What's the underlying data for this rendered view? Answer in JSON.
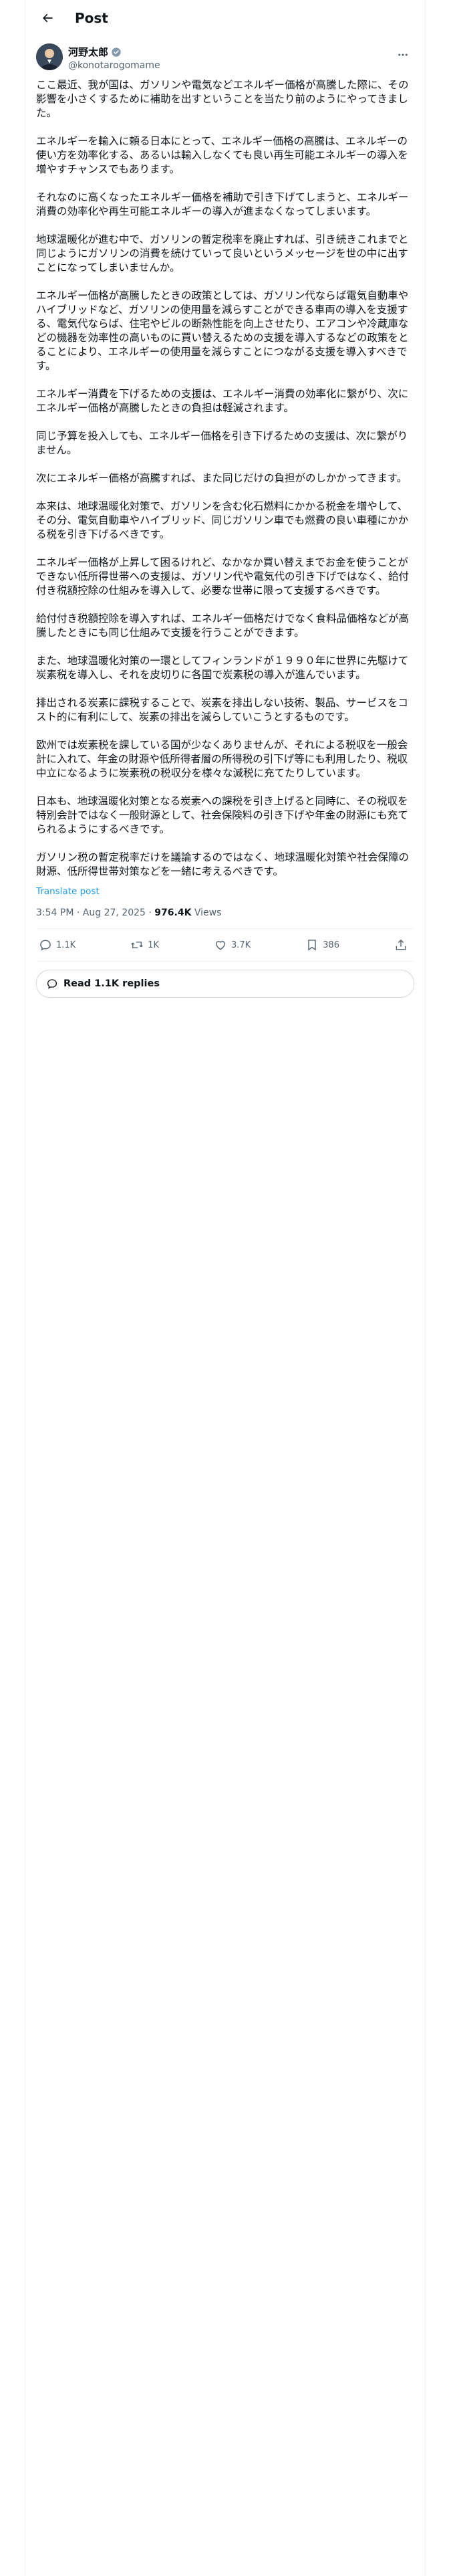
{
  "header": {
    "title": "Post"
  },
  "post": {
    "author_name": "河野太郎",
    "author_handle": "@konotarogomame",
    "paragraphs": [
      "ここ最近、我が国は、ガソリンや電気などエネルギー価格が高騰した際に、その影響を小さくするために補助を出すということを当たり前のようにやってきました。",
      "エネルギーを輸入に頼る日本にとって、エネルギー価格の高騰は、エネルギーの使い方を効率化する、あるいは輸入しなくても良い再生可能エネルギーの導入を増やすチャンスでもあります。",
      "それなのに高くなったエネルギー価格を補助で引き下げてしまうと、エネルギー消費の効率化や再生可能エネルギーの導入が進まなくなってしまいます。",
      "地球温暖化が進む中で、ガソリンの暫定税率を廃止すれば、引き続きこれまでと同じようにガソリンの消費を続けていって良いというメッセージを世の中に出すことになってしまいませんか。",
      "エネルギー価格が高騰したときの政策としては、ガソリン代ならば電気自動車やハイブリッドなど、ガソリンの使用量を減らすことができる車両の導入を支援する、電気代ならば、住宅やビルの断熱性能を向上させたり、エアコンや冷蔵庫などの機器を効率性の高いものに買い替えるための支援を導入するなどの政策をとることにより、エネルギーの使用量を減らすことにつながる支援を導入すべきです。",
      "エネルギー消費を下げるための支援は、エネルギー消費の効率化に繋がり、次にエネルギー価格が高騰したときの負担は軽減されます。",
      "同じ予算を投入しても、エネルギー価格を引き下げるための支援は、次に繋がりません。",
      "次にエネルギー価格が高騰すれば、また同じだけの負担がのしかかってきます。",
      "本来は、地球温暖化対策で、ガソリンを含む化石燃料にかかる税金を増やして、その分、電気自動車やハイブリッド、同じガソリン車でも燃費の良い車種にかかる税を引き下げるべきです。",
      "エネルギー価格が上昇して困るけれど、なかなか買い替えまでお金を使うことができない低所得世帯への支援は、ガソリン代や電気代の引き下げではなく、給付付き税額控除の仕組みを導入して、必要な世帯に限って支援するべきです。",
      "給付付き税額控除を導入すれば、エネルギー価格だけでなく食料品価格などが高騰したときにも同じ仕組みで支援を行うことができます。",
      "また、地球温暖化対策の一環としてフィンランドが１９９０年に世界に先駆けて炭素税を導入し、それを皮切りに各国で炭素税の導入が進んでいます。",
      "排出される炭素に課税することで、炭素を排出しない技術、製品、サービスをコスト的に有利にして、炭素の排出を減らしていこうとするものです。",
      "欧州では炭素税を課している国が少なくありませんが、それによる税収を一般会計に入れて、年金の財源や低所得者層の所得税の引下げ等にも利用したり、税収中立になるように炭素税の税収分を様々な減税に充てたりしています。",
      "日本も、地球温暖化対策となる炭素への課税を引き上げると同時に、その税収を特別会計ではなく一般財源として、社会保険料の引き下げや年金の財源にも充てられるようにするべきです。",
      "ガソリン税の暫定税率だけを議論するのではなく、地球温暖化対策や社会保障の財源、低所得世帯対策などを一緒に考えるべきです。"
    ],
    "translate_label": "Translate post",
    "time": "3:54 PM",
    "date": "Aug 27, 2025",
    "separator": "·",
    "views_count": "976.4K",
    "views_label": "Views"
  },
  "actions": {
    "replies": "1.1K",
    "reposts": "1K",
    "likes": "3.7K",
    "bookmarks": "386"
  },
  "replies_button": {
    "label": "Read 1.1K replies"
  },
  "colors": {
    "accent": "#1d9bf0",
    "text": "#0f1419",
    "muted": "#536471",
    "border": "#eff3f4"
  }
}
